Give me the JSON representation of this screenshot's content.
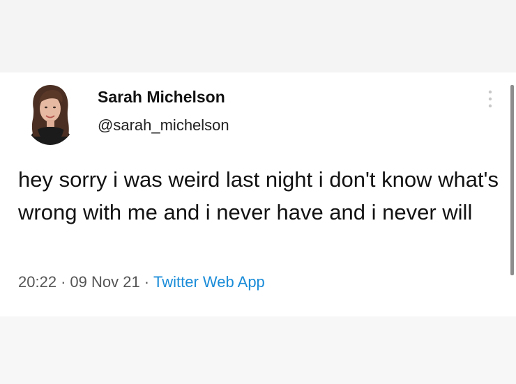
{
  "tweet": {
    "author": {
      "display_name": "Sarah Michelson",
      "handle": "@sarah_michelson",
      "avatar_icon": "profile-photo"
    },
    "more_icon": "vertical-ellipsis-icon",
    "text": "hey sorry i was weird last night i don't know what's wrong with me and i never have and i never will",
    "meta": {
      "time": "20:22",
      "separator": "·",
      "date": "09 Nov 21",
      "source": "Twitter Web App"
    }
  },
  "colors": {
    "background": "#f6f6f6",
    "card": "#ffffff",
    "text": "#121212",
    "meta_text": "#555555",
    "link": "#1a8cd8"
  }
}
